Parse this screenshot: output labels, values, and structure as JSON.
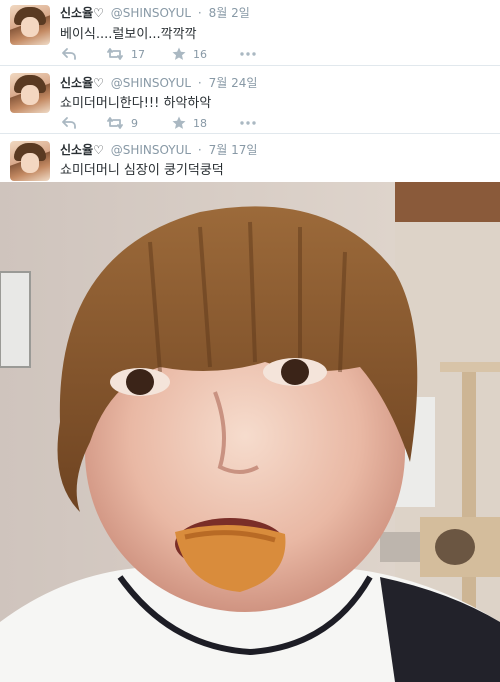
{
  "tweets": [
    {
      "name": "신소율♡",
      "handle": "@SHINSOYUL",
      "separator": "·",
      "time": "8월 2일",
      "text": "베이식....럴보이...깍깍깍",
      "retweets": "17",
      "favorites": "16"
    },
    {
      "name": "신소율♡",
      "handle": "@SHINSOYUL",
      "separator": "·",
      "time": "7월 24일",
      "text": "쇼미더머니한다!!! 하악하악",
      "retweets": "9",
      "favorites": "18"
    },
    {
      "name": "신소율♡",
      "handle": "@SHINSOYUL",
      "separator": "·",
      "time": "7월 17일",
      "text": "쇼미더머니 심장이 쿵기덕쿵덕"
    }
  ],
  "icons": {
    "reply": "reply-icon",
    "retweet": "retweet-icon",
    "favorite": "star-icon",
    "more": "more-icon"
  },
  "colors": {
    "text": "#292f33",
    "muted": "#8899a6",
    "divider": "#e1e8ed",
    "icon": "#aab8c2"
  }
}
